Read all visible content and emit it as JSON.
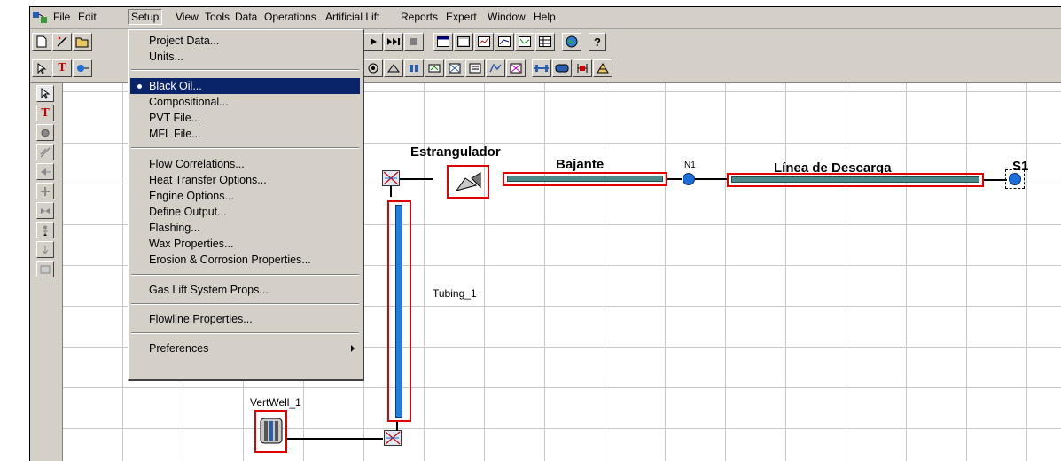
{
  "menubar": {
    "items": [
      "File",
      "Edit",
      "Setup",
      "View",
      "Tools",
      "Data",
      "Operations",
      "Artificial Lift",
      "Reports",
      "Expert",
      "Window",
      "Help"
    ]
  },
  "setup_menu": {
    "items": [
      {
        "label": "Project Data..."
      },
      {
        "label": "Units..."
      },
      {
        "label": "Black Oil...",
        "selected": true
      },
      {
        "label": "Compositional..."
      },
      {
        "label": "PVT File..."
      },
      {
        "label": "MFL File..."
      },
      {
        "label": "Flow Correlations..."
      },
      {
        "label": "Heat Transfer Options..."
      },
      {
        "label": "Engine Options..."
      },
      {
        "label": "Define Output..."
      },
      {
        "label": "Flashing..."
      },
      {
        "label": "Wax Properties..."
      },
      {
        "label": "Erosion & Corrosion Properties..."
      },
      {
        "label": "Gas Lift System Props..."
      },
      {
        "label": "Flowline Properties..."
      },
      {
        "label": "Preferences",
        "submenu": true
      }
    ]
  },
  "toolbar_icons": {
    "row1": [
      "new-icon",
      "wand-icon",
      "open-icon",
      "run-icon",
      "run-to-end-icon",
      "stop-icon",
      "window-icon",
      "window-icon-2",
      "chart-icon",
      "chart-icon-2",
      "chart-icon-3",
      "table-icon",
      "globe-icon",
      "help-icon"
    ],
    "row2": [
      "select-arrow-icon",
      "text-tool-icon",
      "source-icon",
      "well-icon",
      "choke-icon",
      "connector-icon",
      "flowline-icon",
      "pump-icon",
      "compressor-icon",
      "separator-icon",
      "expander-icon",
      "junction-icon",
      "heater-icon",
      "cooler-icon",
      "platform-icon"
    ]
  },
  "left_palette_icons": [
    "select-arrow-icon",
    "text-tool-icon",
    "source-icon",
    "injector-icon",
    "choke-icon",
    "junction-icon",
    "valve-icon",
    "person-icon",
    "sink-icon",
    "report-icon"
  ],
  "diagram": {
    "estrangulador": "Estrangulador",
    "bajante": "Bajante",
    "n1": "N1",
    "linea": "Línea de Descarga",
    "s1": "S1",
    "tubing": "Tubing_1",
    "vertwell": "VertWell_1"
  },
  "colors": {
    "menu_bg": "#d4d0c8",
    "selection": "#0a246a",
    "highlight_box": "#e00000",
    "pipe_blue": "#1e7fe0",
    "pipe_teal": "#4a8a8a"
  }
}
